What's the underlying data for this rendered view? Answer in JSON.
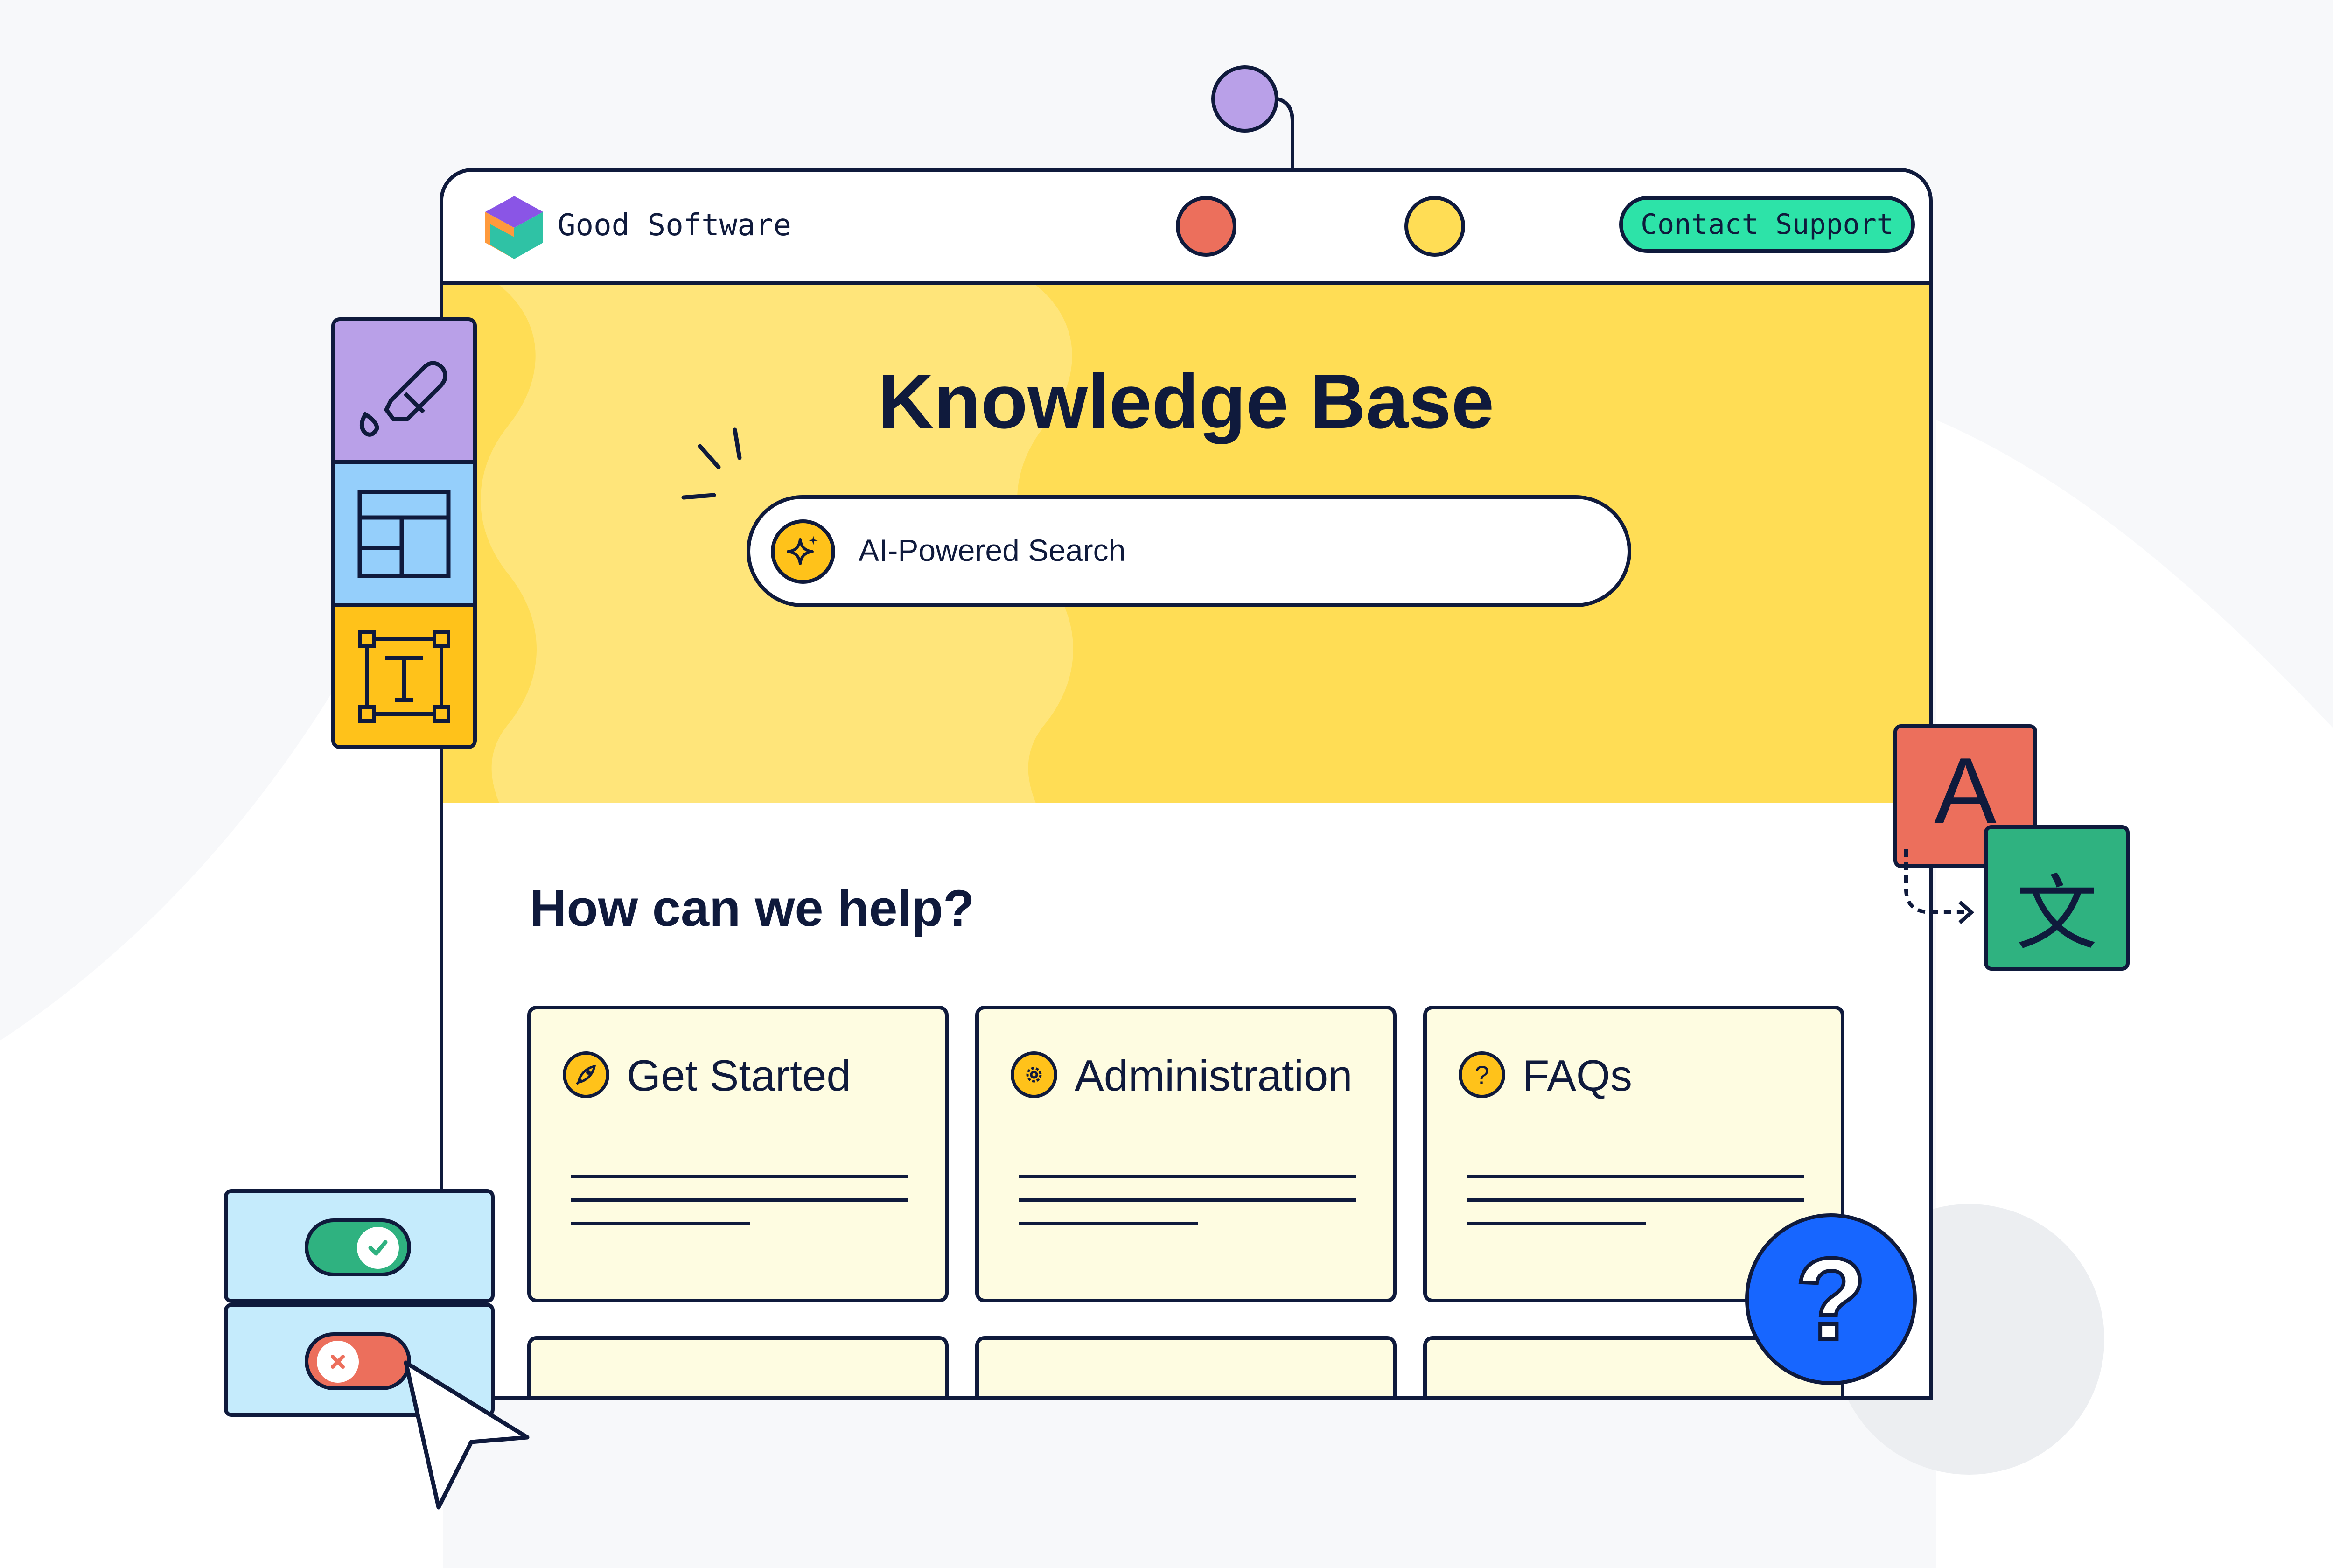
{
  "brand": {
    "name": "Good Software"
  },
  "header": {
    "contact_label": "Contact Support"
  },
  "hero": {
    "title": "Knowledge Base",
    "search_placeholder": "AI-Powered Search"
  },
  "help": {
    "heading": "How can we help?",
    "cards": [
      {
        "label": "Get Started",
        "icon": "rocket-icon"
      },
      {
        "label": "Administration",
        "icon": "gear-icon"
      },
      {
        "label": "FAQs",
        "icon": "question-icon"
      }
    ]
  },
  "translate": {
    "source_glyph": "A",
    "target_glyph": "文"
  },
  "help_fab": {
    "glyph": "?"
  },
  "colors": {
    "ink": "#0f1a3c",
    "hero_yellow": "#ffdd55",
    "hero_light": "#ffe57a",
    "accent_green": "#2de3a8",
    "card_bg": "#fefce1",
    "purple": "#b9a0e8",
    "blue": "#95cffb",
    "gold": "#ffc21a",
    "red": "#ec6f5c",
    "teal": "#2fb280",
    "fab_blue": "#1766ff",
    "toggle_bg": "#c5ebfc"
  }
}
